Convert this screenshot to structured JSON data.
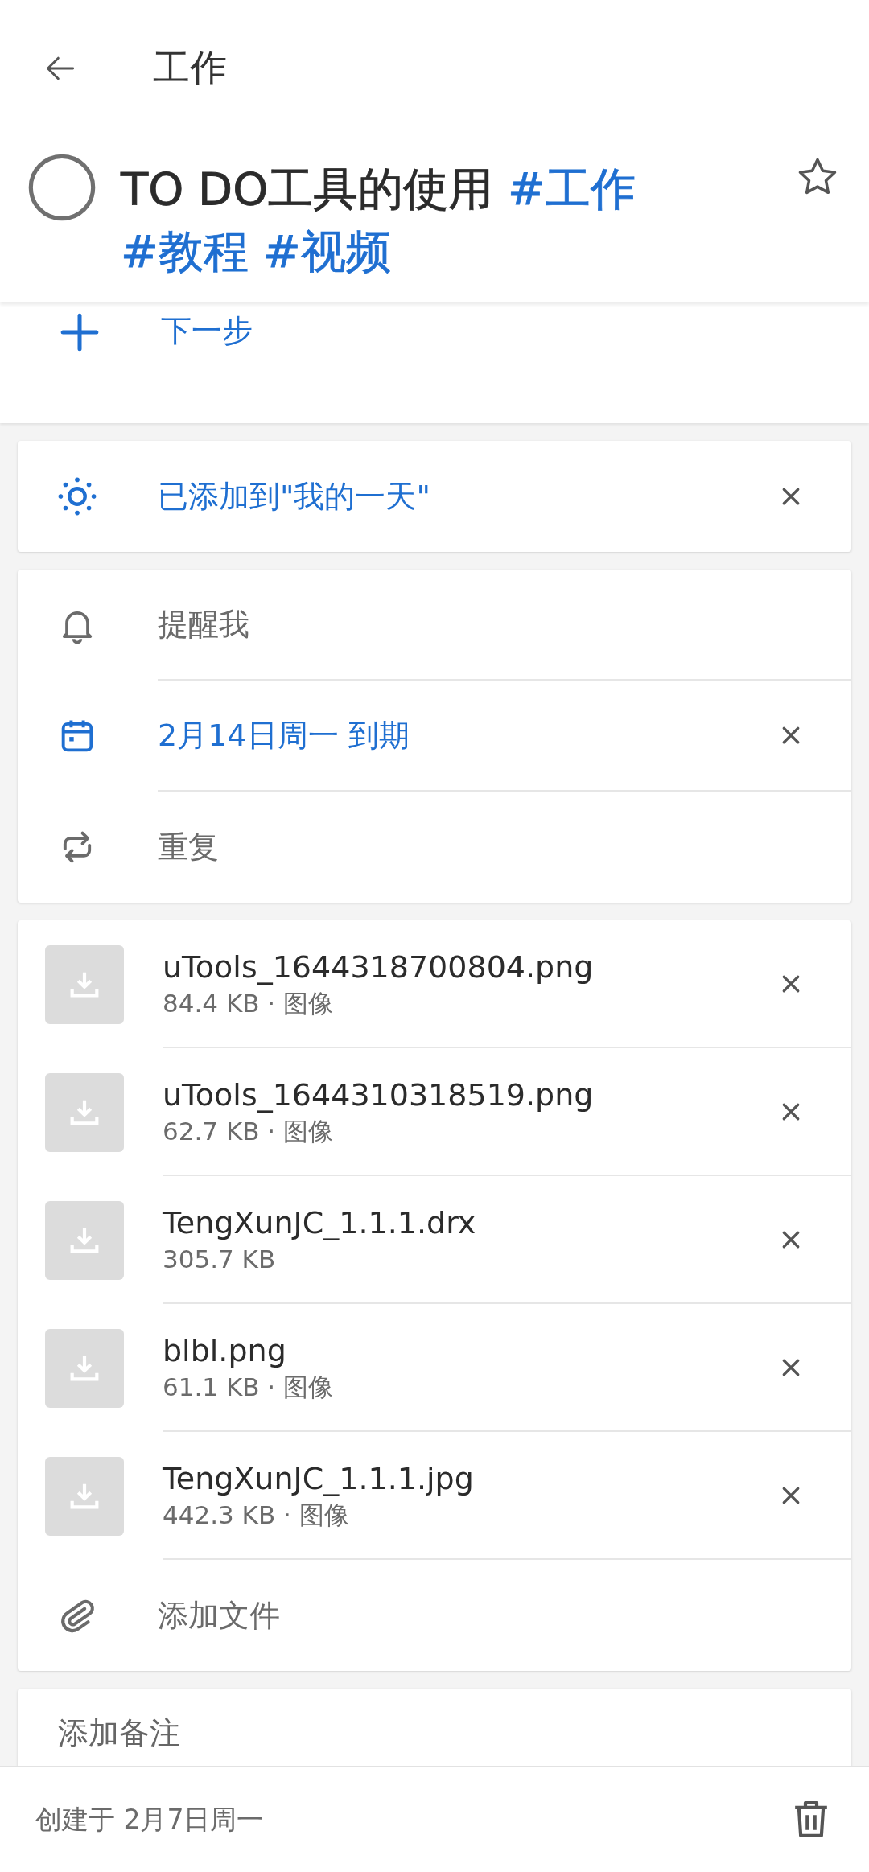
{
  "header": {
    "title": "工作"
  },
  "task": {
    "title": "TO DO工具的使用",
    "tags": [
      "#工作",
      "#教程",
      "#视频"
    ],
    "completed": false,
    "starred": false
  },
  "next_step": {
    "label": "下一步"
  },
  "my_day": {
    "label": "已添加到\"我的一天\"",
    "added": true
  },
  "schedule": [
    {
      "kind": "reminder",
      "label": "提醒我",
      "active": false
    },
    {
      "kind": "due",
      "label": "2月14日周一 到期",
      "active": true
    },
    {
      "kind": "repeat",
      "label": "重复",
      "active": false
    }
  ],
  "files": [
    {
      "name": "uTools_1644318700804.png",
      "meta": "84.4 KB · 图像"
    },
    {
      "name": "uTools_1644310318519.png",
      "meta": "62.7 KB · 图像"
    },
    {
      "name": "TengXunJC_1.1.1.drx",
      "meta": "305.7 KB"
    },
    {
      "name": "blbl.png",
      "meta": "61.1 KB · 图像"
    },
    {
      "name": "TengXunJC_1.1.1.jpg",
      "meta": "442.3 KB · 图像"
    }
  ],
  "add_file": {
    "label": "添加文件"
  },
  "note": {
    "placeholder": "添加备注"
  },
  "footer": {
    "created": "创建于 2月7日周一"
  }
}
